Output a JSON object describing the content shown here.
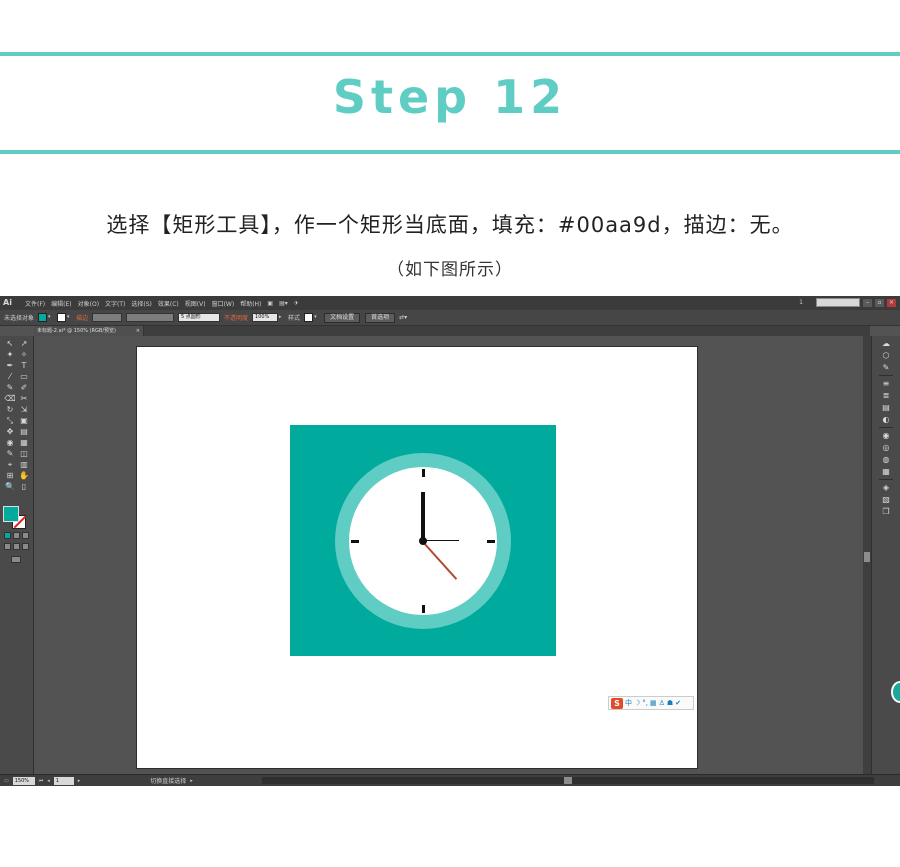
{
  "header": {
    "title": "Step 12",
    "accent_color": "#5fcdc4"
  },
  "instruction": {
    "text": "选择【矩形工具】，作一个矩形当底面，填充：#00aa9d，描边：无。",
    "note": "（如下图所示）"
  },
  "app": {
    "logo": "Ai",
    "menu": [
      "文件(F)",
      "编辑(E)",
      "对象(O)",
      "文字(T)",
      "选择(S)",
      "效果(C)",
      "视图(V)",
      "窗口(W)",
      "帮助(H)"
    ],
    "page_indicator": "1",
    "window_buttons": [
      "–",
      "▫",
      "×"
    ],
    "control_bar": {
      "selection_label": "未选择对象",
      "stroke_label": "描边",
      "brush_value": "5 点圆形",
      "opacity_label": "不透明度",
      "opacity_value": "100%",
      "style_label": "样式",
      "document_setup_button": "文档设置",
      "preferences_button": "首选项"
    },
    "document_tab": {
      "title": "未标题-2.ai* @ 150% (RGB/预览)",
      "close": "×"
    },
    "fill_color": "#00aa9d",
    "stroke": "none",
    "tools": [
      "↖",
      "↗",
      "✦",
      "✧",
      "✒",
      "T",
      "⁄",
      "▭",
      "✎",
      "✐",
      "⌫",
      "✂",
      "↻",
      "⇲",
      "⤡",
      "▣",
      "✥",
      "▤",
      "◉",
      "▦",
      "✎",
      "◫",
      "⌖",
      "▥",
      "⊞",
      "✋",
      "🔍",
      "▯"
    ],
    "right_panel_icons": [
      "☁",
      "⬡",
      "✎",
      "≡",
      "≣",
      "▤",
      "◐",
      "◉",
      "◎",
      "◍",
      "▦",
      "◈",
      "▧",
      "❐"
    ],
    "ime_toolbar": {
      "logo": "S",
      "icons": [
        "中",
        "☽",
        "°,",
        "▦",
        "♙",
        "☗",
        "✔"
      ]
    },
    "status": {
      "zoom_value": "150%",
      "artboard_value": "1",
      "tool_name": "切换直接选择"
    }
  },
  "artwork": {
    "rect_fill": "#00aa9d",
    "ring_color": "#5fcdc4",
    "face_color": "#ffffff",
    "second_hand_color": "#b5492f"
  }
}
